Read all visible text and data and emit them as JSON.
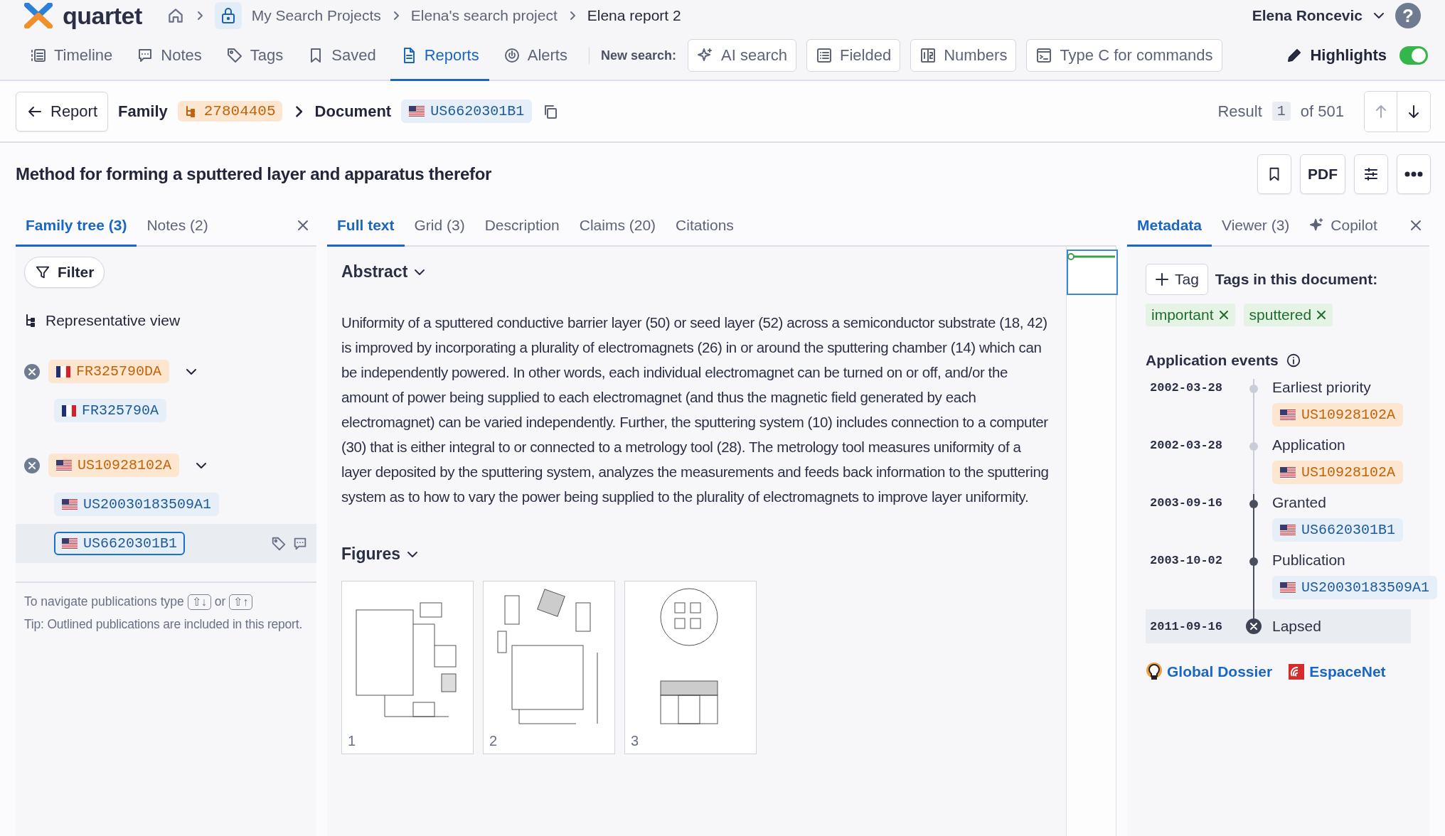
{
  "header": {
    "logo": "quartet",
    "breadcrumbs": [
      "My Search Projects",
      "Elena's search project",
      "Elena report 2"
    ],
    "user": "Elena Roncevic",
    "help": "?"
  },
  "nav": {
    "items": [
      {
        "kind": "timeline",
        "label": "Timeline",
        "selected": false
      },
      {
        "kind": "notes",
        "label": "Notes",
        "selected": false
      },
      {
        "kind": "tags",
        "label": "Tags",
        "selected": false
      },
      {
        "kind": "saved",
        "label": "Saved",
        "selected": false
      },
      {
        "kind": "reports",
        "label": "Reports",
        "selected": true
      },
      {
        "kind": "alerts",
        "label": "Alerts",
        "selected": false
      }
    ],
    "new_search_label": "New search:",
    "search_buttons": [
      {
        "kind": "ai",
        "label": "AI search"
      },
      {
        "kind": "fielded",
        "label": "Fielded"
      },
      {
        "kind": "numbers",
        "label": "Numbers"
      },
      {
        "kind": "command",
        "label": "Type C for commands"
      }
    ],
    "highlights": {
      "label": "Highlights",
      "on": true
    }
  },
  "toolbar": {
    "back": "Report",
    "family_label": "Family",
    "family_id": "27804405",
    "document_label": "Document",
    "document": {
      "id": "US6620301B1",
      "kind": "publication",
      "flag": {
        "kind": "us"
      }
    },
    "result_label": "Result",
    "result_index": "1",
    "result_total": "of 501"
  },
  "title": "Method for forming a sputtered layer and apparatus therefor",
  "actions": {
    "pdf": "PDF"
  },
  "left": {
    "tabs": [
      {
        "label": "Family tree (3)",
        "selected": true
      },
      {
        "label": "Notes (2)",
        "selected": false
      }
    ],
    "filter": "Filter",
    "view": "Representative view",
    "tree": [
      {
        "id": "FR325790DA",
        "flag": {
          "kind": "fr"
        },
        "kind": "application",
        "expanded": true,
        "selected": false,
        "in_report": false,
        "children": [
          {
            "id": "FR325790A",
            "flag": {
              "kind": "fr"
            },
            "kind": "publication",
            "selected": false,
            "in_report": false
          }
        ]
      },
      {
        "id": "US10928102A",
        "flag": {
          "kind": "us"
        },
        "kind": "application",
        "expanded": true,
        "selected": false,
        "in_report": false,
        "children": [
          {
            "id": "US20030183509A1",
            "flag": {
              "kind": "us"
            },
            "kind": "publication",
            "selected": false,
            "in_report": false
          },
          {
            "id": "US6620301B1",
            "flag": {
              "kind": "us"
            },
            "kind": "publication",
            "selected": true,
            "in_report": true
          }
        ]
      }
    ],
    "hint": {
      "text": "To navigate publications type",
      "key_down": "⇧↓",
      "or": "or",
      "key_up": "⇧↑"
    },
    "tip": "Tip: Outlined publications are included in this report."
  },
  "center": {
    "tabs": [
      {
        "label": "Full text",
        "selected": true
      },
      {
        "label": "Grid (3)",
        "selected": false
      },
      {
        "label": "Description",
        "selected": false
      },
      {
        "label": "Claims (20)",
        "selected": false
      },
      {
        "label": "Citations",
        "selected": false
      }
    ],
    "abstract_heading": "Abstract",
    "abstract": "Uniformity of a sputtered conductive barrier layer (50) or seed layer (52) across a semiconductor substrate (18, 42) is improved by incorporating a plurality of electromagnets (26) in or around the sputtering chamber (14) which can be independently powered. In other words, each individual electromagnet can be turned on or off, and/or the amount of power being supplied to each electromagnet (and thus the magnetic field generated by each electromagnet) can be varied independently. Further, the sputtering system (10) includes connection to a computer (30) that is either integral to or connected to a metrology tool (28). The metrology tool measures uniformity of a layer deposited by the sputtering system, analyzes the measurements and feeds back information to the sputtering system as to how to vary the power being supplied to the plurality of electromagnets to improve layer uniformity.",
    "figures_heading": "Figures",
    "figures": [
      {
        "number": "1",
        "kind": "picture"
      },
      {
        "number": "2",
        "kind": "picture"
      },
      {
        "number": "3",
        "kind": "picture"
      }
    ]
  },
  "right": {
    "tabs": [
      {
        "kind": "plain",
        "label": "Metadata",
        "selected": true
      },
      {
        "kind": "plain",
        "label": "Viewer (3)",
        "selected": false
      },
      {
        "kind": "copilot",
        "label": "Copilot",
        "selected": false
      }
    ],
    "tag_button": "Tag",
    "tags_label": "Tags in this document:",
    "tags": [
      "important",
      "sputtered"
    ],
    "events_heading": "Application events",
    "events": [
      {
        "date": "2002-03-28",
        "label": "Earliest priority",
        "kind": "open",
        "highlighted": false,
        "publication": {
          "id": "US10928102A",
          "kind": "application",
          "flag": {
            "kind": "us"
          }
        }
      },
      {
        "date": "2002-03-28",
        "label": "Application",
        "kind": "open",
        "highlighted": false,
        "publication": {
          "id": "US10928102A",
          "kind": "application",
          "flag": {
            "kind": "us"
          }
        }
      },
      {
        "date": "2003-09-16",
        "label": "Granted",
        "kind": "filled",
        "highlighted": false,
        "publication": {
          "id": "US6620301B1",
          "kind": "publication",
          "flag": {
            "kind": "us"
          }
        }
      },
      {
        "date": "2003-10-02",
        "label": "Publication",
        "kind": "filled",
        "highlighted": false,
        "publication": {
          "id": "US20030183509A1",
          "kind": "publication",
          "flag": {
            "kind": "us"
          }
        }
      },
      {
        "date": "2011-09-16",
        "label": "Lapsed",
        "kind": "cross",
        "highlighted": true
      }
    ],
    "links": [
      {
        "kind": "dossier",
        "label": "Global Dossier"
      },
      {
        "kind": "espacenet",
        "label": "EspaceNet"
      }
    ]
  }
}
